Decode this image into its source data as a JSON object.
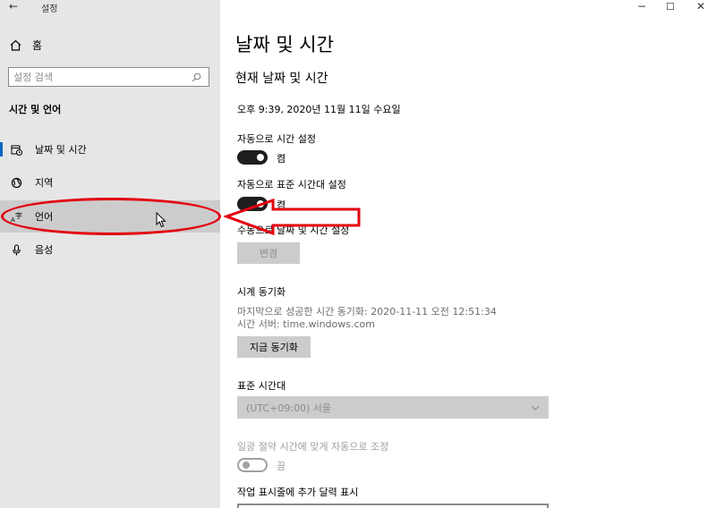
{
  "window": {
    "back_glyph": "←",
    "title": "설정",
    "minimize_glyph": "−",
    "maximize_glyph": "☐",
    "close_glyph": "✕"
  },
  "sidebar": {
    "home_label": "홈",
    "search_placeholder": "설정 검색",
    "section_title": "시간 및 언어",
    "items": [
      {
        "label": "날짜 및 시간",
        "icon": "calendar-clock-icon"
      },
      {
        "label": "지역",
        "icon": "globe-icon"
      },
      {
        "label": "언어",
        "icon": "language-icon"
      },
      {
        "label": "음성",
        "icon": "microphone-icon"
      }
    ]
  },
  "main": {
    "page_title": "날짜 및 시간",
    "subheading": "현재 날짜 및 시간",
    "current_datetime": "오후 9:39, 2020년 11월 11일 수요일",
    "auto_time": {
      "label": "자동으로 시간 설정",
      "state": "켬"
    },
    "auto_timezone": {
      "label": "자동으로 표준 시간대 설정",
      "state": "켬"
    },
    "manual": {
      "label": "수동으로 날짜 및 시간 설정",
      "button": "변경"
    },
    "sync": {
      "heading": "시계 동기화",
      "last_sync": "마지막으로 성공한 시간 동기화: 2020-11-11 오전 12:51:34",
      "server": "시간 서버: time.windows.com",
      "button": "지금 동기화"
    },
    "timezone": {
      "heading": "표준 시간대",
      "value": "(UTC+09:00) 서울"
    },
    "dst": {
      "label": "일광 절약 시간에 맞게 자동으로 조정",
      "state": "끔"
    },
    "calendar": {
      "label": "작업 표시줄에 추가 달력 표시"
    }
  },
  "annotation_color": "#e3000f",
  "accent_color": "#0067c0"
}
